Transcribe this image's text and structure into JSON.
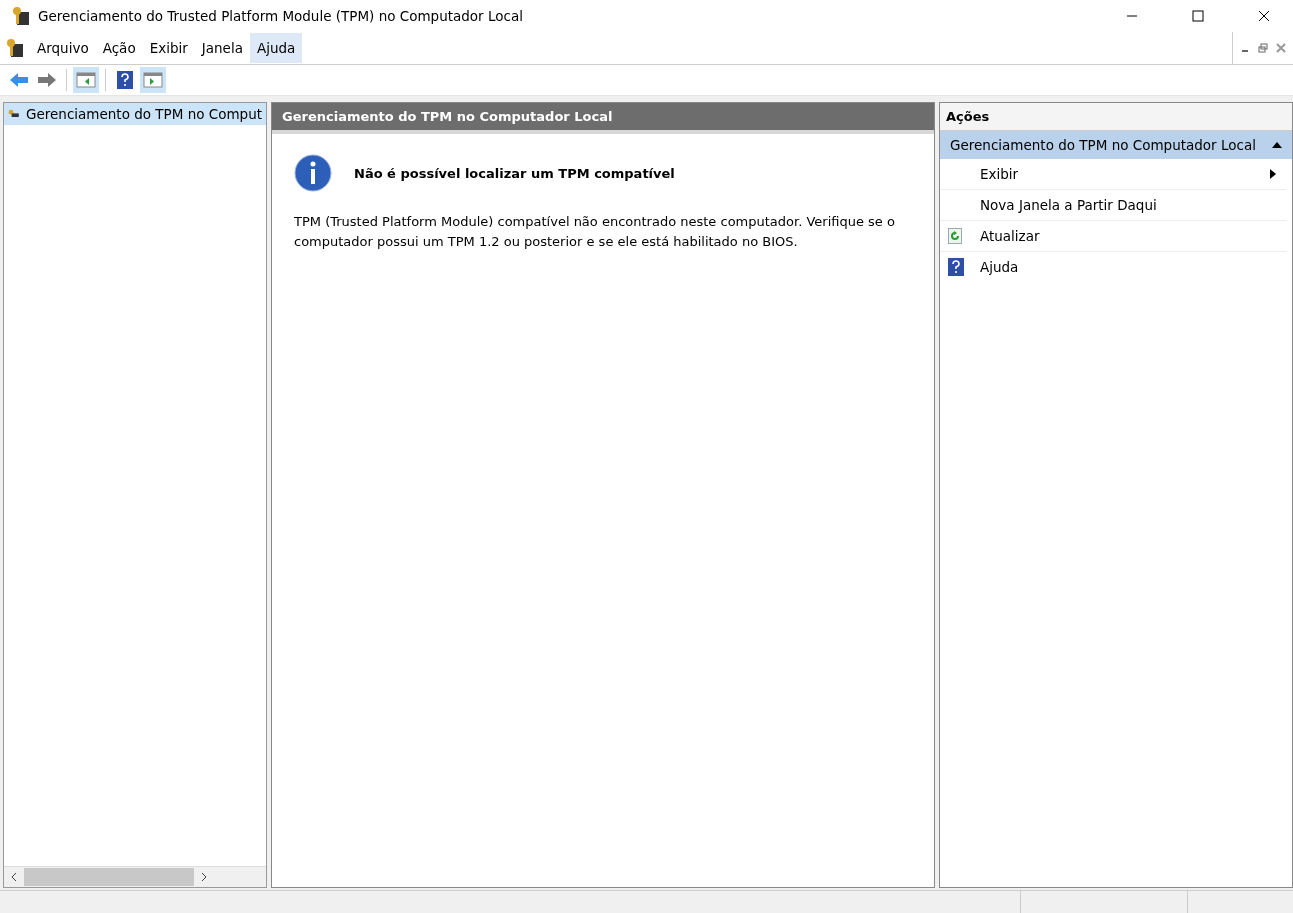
{
  "window": {
    "title": "Gerenciamento do Trusted Platform Module (TPM) no Computador Local"
  },
  "menu": [
    {
      "label": "Arquivo",
      "selected": false
    },
    {
      "label": "Ação",
      "selected": false
    },
    {
      "label": "Exibir",
      "selected": false
    },
    {
      "label": "Janela",
      "selected": false
    },
    {
      "label": "Ajuda",
      "selected": true
    }
  ],
  "toolbar": [
    {
      "kind": "back",
      "on": false
    },
    {
      "kind": "forward",
      "on": false
    },
    {
      "kind": "console-tree",
      "on": true
    },
    {
      "kind": "help",
      "on": false
    },
    {
      "kind": "action-pane",
      "on": true
    }
  ],
  "tree": {
    "items": [
      {
        "label": "Gerenciamento do TPM no Comput",
        "selected": true
      }
    ]
  },
  "content": {
    "header": "Gerenciamento do TPM no Computador Local",
    "message_title": "Não é possível localizar um TPM compatível",
    "message_body": "TPM (Trusted Platform Module) compatível não encontrado neste computador. Verifique se o computador possui um TPM 1.2 ou posterior e se ele está habilitado no BIOS."
  },
  "actions": {
    "title": "Ações",
    "section": {
      "label": "Gerenciamento do TPM no Computador Local",
      "expanded": true
    },
    "items": [
      {
        "label": "Exibir",
        "kind": "submenu"
      },
      {
        "label": "Nova Janela a Partir Daqui",
        "kind": "plain"
      },
      {
        "label": "Atualizar",
        "kind": "refresh"
      },
      {
        "label": "Ajuda",
        "kind": "help"
      }
    ]
  }
}
